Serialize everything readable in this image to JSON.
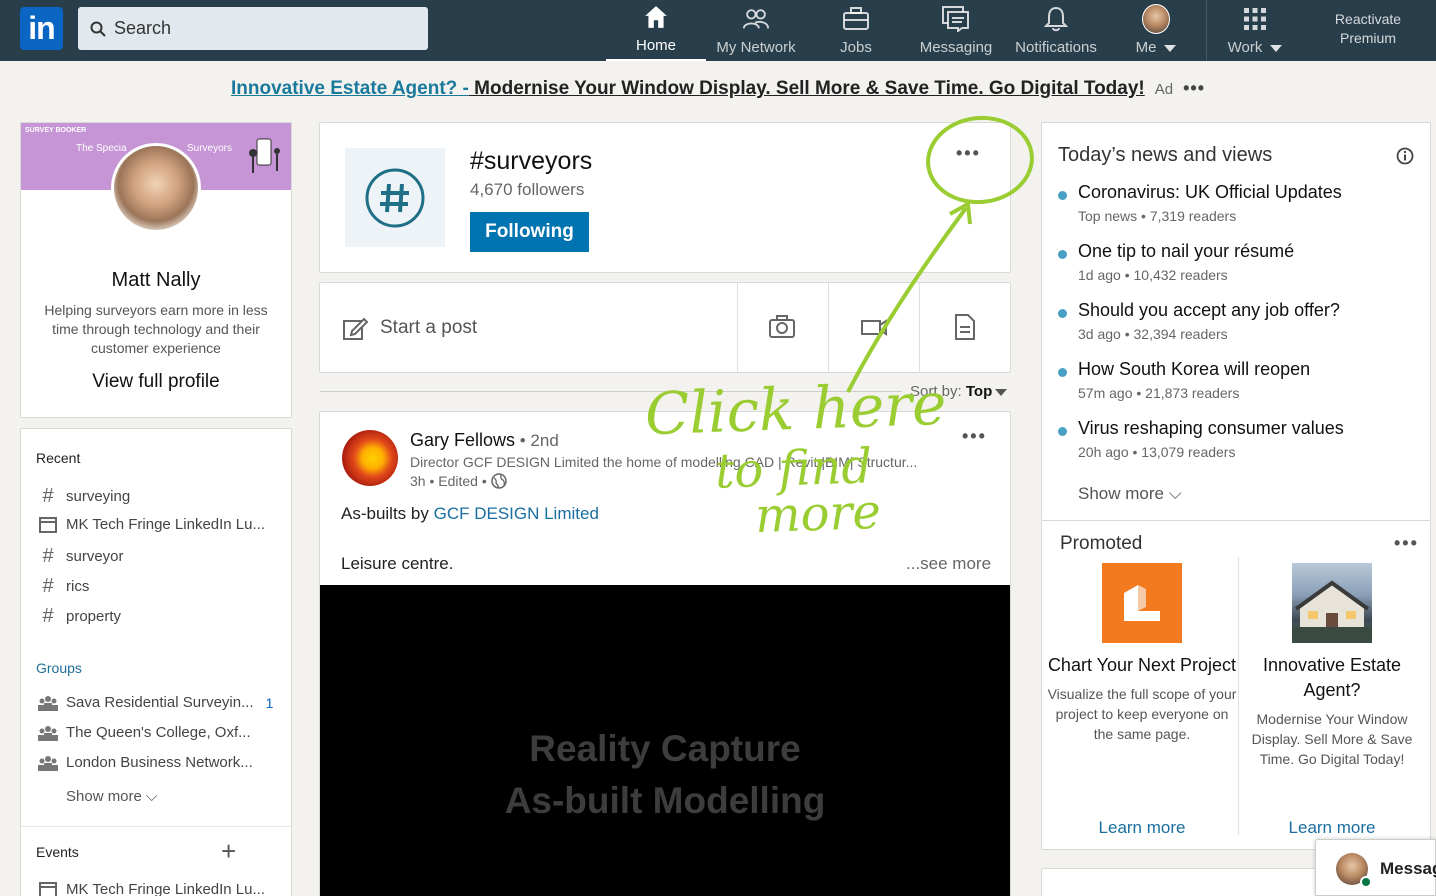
{
  "nav": {
    "search_placeholder": "Search",
    "items": [
      {
        "label": "Home",
        "icon": "home-icon"
      },
      {
        "label": "My Network",
        "icon": "network-icon"
      },
      {
        "label": "Jobs",
        "icon": "briefcase-icon"
      },
      {
        "label": "Messaging",
        "icon": "messaging-icon"
      },
      {
        "label": "Notifications",
        "icon": "bell-icon"
      },
      {
        "label": "Me",
        "icon": "avatar"
      },
      {
        "label": "Work",
        "icon": "grid-icon"
      }
    ],
    "premium_line1": "Reactivate",
    "premium_line2": "Premium",
    "logo": "in"
  },
  "ad": {
    "link1": "Innovative Estate Agent? -",
    "link2": " Modernise Your Window Display. Sell More & Save Time. Go Digital Today!",
    "tag": "Ad",
    "dots": "•••"
  },
  "profile": {
    "banner_logo": "SURVEY BOOKER",
    "banner_text1": "The Specia",
    "banner_text2": "Surveyors",
    "name": "Matt Nally",
    "description": "Helping surveyors earn more in less time through technology and their customer experience",
    "view_link": "View full profile"
  },
  "recent": {
    "title": "Recent",
    "items": [
      {
        "type": "hashtag",
        "label": "surveying"
      },
      {
        "type": "event",
        "label": "MK Tech Fringe LinkedIn Lu..."
      },
      {
        "type": "hashtag",
        "label": "surveyor"
      },
      {
        "type": "hashtag",
        "label": "rics"
      },
      {
        "type": "hashtag",
        "label": "property"
      }
    ],
    "groups_title": "Groups",
    "groups": [
      {
        "label": "Sava Residential Surveyin...",
        "count": "1"
      },
      {
        "label": "The Queen's College, Oxf..."
      },
      {
        "label": "London Business Network..."
      }
    ],
    "show_more": "Show more",
    "events_title": "Events",
    "events_add": "+",
    "events": [
      {
        "label": "MK Tech Fringe LinkedIn Lu..."
      }
    ]
  },
  "hashtag": {
    "title": "#surveyors",
    "followers": "4,670 followers",
    "follow_label": "Following",
    "more": "•••"
  },
  "share": {
    "start_post": "Start a post"
  },
  "sort": {
    "label": "Sort by:",
    "value": "Top"
  },
  "post": {
    "author": "Gary Fellows",
    "degree": " • 2nd",
    "headline": "Director GCF DESIGN Limited the home of modelling CAD | Revit |BIM| Structur...",
    "time": "3h • Edited •",
    "text_prefix": "As-builts by ",
    "text_link": "GCF DESIGN Limited",
    "text2": "Leisure centre.",
    "see_more": "...see more",
    "video_line1": "Reality Capture",
    "video_line2": "As-built Modelling",
    "more": "•••"
  },
  "news": {
    "title": "Today’s news and views",
    "items": [
      {
        "headline": "Coronavirus: UK Official Updates",
        "meta": "Top news • 7,319 readers"
      },
      {
        "headline": "One tip to nail your résumé",
        "meta": "1d ago • 10,432 readers"
      },
      {
        "headline": "Should you accept any job offer?",
        "meta": "3d ago • 32,394 readers"
      },
      {
        "headline": "How South Korea will reopen",
        "meta": "57m ago • 21,873 readers"
      },
      {
        "headline": "Virus reshaping consumer values",
        "meta": "20h ago • 13,079 readers"
      }
    ],
    "show_more": "Show more"
  },
  "promoted": {
    "title": "Promoted",
    "more": "•••",
    "items": [
      {
        "headline": "Chart Your Next Project",
        "desc": "Visualize the full scope of your project to keep everyone on the same page.",
        "link": "Learn more"
      },
      {
        "headline": "Innovative Estate Agent?",
        "desc": "Modernise Your Window Display. Sell More & Save Time. Go Digital Today!",
        "link": "Learn more"
      }
    ]
  },
  "messaging_widget": {
    "label": "Messag"
  },
  "annotation": {
    "line1": "Click here",
    "line2": "to find",
    "line3": "more",
    "color": "#9acd32"
  },
  "colors": {
    "nav_bg": "#283e4a",
    "brand": "#0073b1",
    "page_bg": "#f3f2ef"
  }
}
